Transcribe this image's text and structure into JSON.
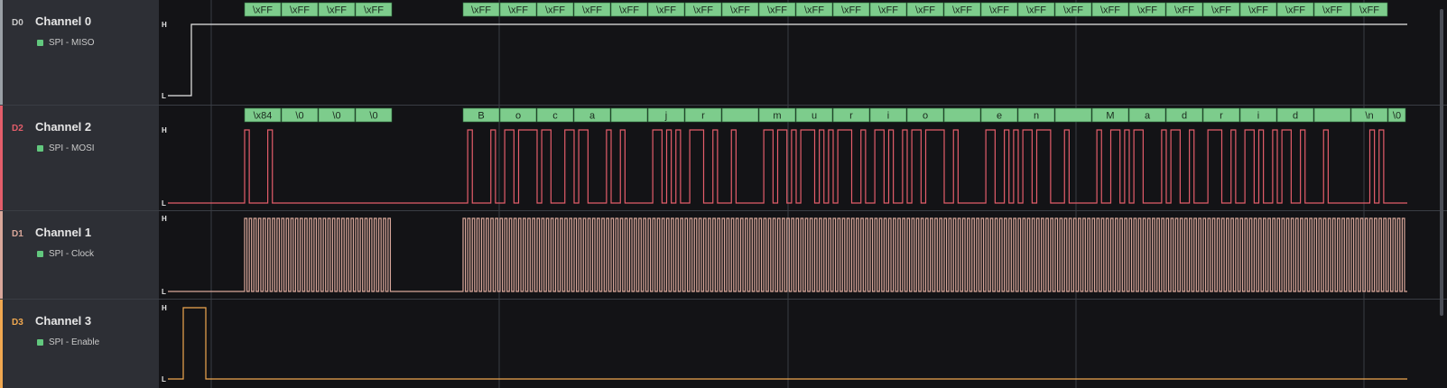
{
  "colors": {
    "background": "#131316",
    "panel": "#2d2f35",
    "decoded_bar": "#7dcc8c",
    "decoded_bar_dark": "#2d6b3c",
    "miso_wave": "#e8e8e8",
    "mosi_wave": "#e35d6a",
    "clock_wave": "#d9a79a",
    "enable_wave": "#f0a850",
    "gridline": "#3a3d44"
  },
  "level_labels": {
    "high": "H",
    "low": "L"
  },
  "channels": [
    {
      "id": "miso",
      "tag": "D0",
      "name": "Channel 0",
      "analyzer": "SPI - MISO",
      "accent": "#9aa0a6",
      "decoded": [
        "\\xFF",
        "\\xFF",
        "\\xFF",
        "\\xFF",
        "\\xFF",
        "\\xFF",
        "\\xFF",
        "\\xFF",
        "\\xFF",
        "\\xFF",
        "\\xFF",
        "\\xFF",
        "\\xFF",
        "\\xFF",
        "\\xFF",
        "\\xFF",
        "\\xFF",
        "\\xFF",
        "\\xFF",
        "\\xFF",
        "\\xFF",
        "\\xFF",
        "\\xFF",
        "\\xFF",
        "\\xFF",
        "\\xFF",
        "\\xFF",
        "\\xFF",
        "\\xFF"
      ]
    },
    {
      "id": "mosi",
      "tag": "D2",
      "name": "Channel 2",
      "analyzer": "SPI - MOSI",
      "accent": "#e35d6a",
      "decoded": [
        "\\x84",
        "\\0",
        "\\0",
        "\\0",
        "B",
        "o",
        "c",
        "a",
        " ",
        "j",
        "r",
        " ",
        "m",
        "u",
        "r",
        "i",
        "o",
        " ",
        "e",
        "n",
        " ",
        "M",
        "a",
        "d",
        "r",
        "i",
        "d",
        " ",
        "\\n",
        "\\0"
      ]
    },
    {
      "id": "clock",
      "tag": "D1",
      "name": "Channel 1",
      "analyzer": "SPI - Clock",
      "accent": "#d9a79a",
      "decoded": []
    },
    {
      "id": "enable",
      "tag": "D3",
      "name": "Channel 3",
      "analyzer": "SPI - Enable",
      "accent": "#f0a850",
      "decoded": []
    }
  ]
}
